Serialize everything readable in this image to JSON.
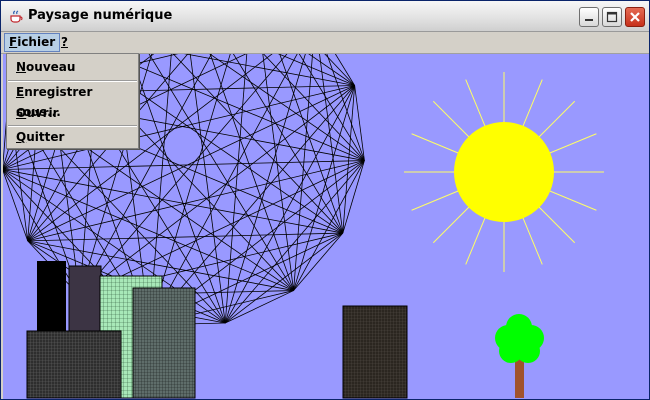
{
  "window": {
    "title": "Paysage numérique",
    "buttons": {
      "minimize": "minimize-icon",
      "maximize": "maximize-icon",
      "close": "close-icon"
    }
  },
  "menubar": {
    "fichier": {
      "first": "F",
      "rest": "ichier"
    },
    "help": "?"
  },
  "fichier_menu": {
    "nouveau": {
      "first": "N",
      "rest": "ouveau"
    },
    "enregistrer": {
      "first": "E",
      "rest": "nregistrer sous..."
    },
    "ouvrir": {
      "first": "O",
      "rest": "uvrir"
    },
    "quitter": {
      "first": "Q",
      "rest": "uitter"
    }
  },
  "scene": {
    "sky_color": "#9999ff",
    "sun_color": "#ffff00",
    "sun_ray_color": "#ffff66",
    "tree_leaf_color": "#00ff00",
    "tree_trunk_color": "#a0522d",
    "web_line_color": "#000000"
  }
}
